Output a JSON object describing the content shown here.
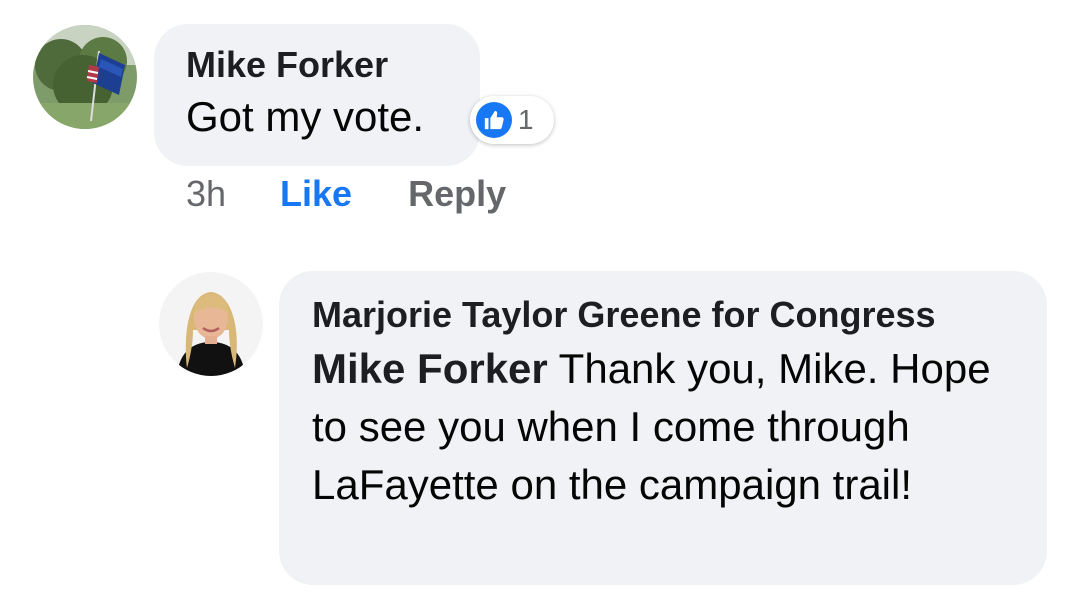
{
  "comment": {
    "author": "Mike Forker",
    "text": "Got my vote.",
    "reaction": {
      "icon": "thumbs-up-icon",
      "count": "1",
      "color": "#1877f2"
    },
    "actions": {
      "time": "3h",
      "like": "Like",
      "reply": "Reply"
    }
  },
  "reply": {
    "author": "Marjorie Taylor Greene for Congress",
    "mention": "Mike Forker",
    "text": " Thank you, Mike. Hope to see you when I come through LaFayette on the campaign trail!"
  },
  "colors": {
    "bubble": "#f0f2f5",
    "link_blue": "#1877f2",
    "secondary_text": "#65676b"
  }
}
